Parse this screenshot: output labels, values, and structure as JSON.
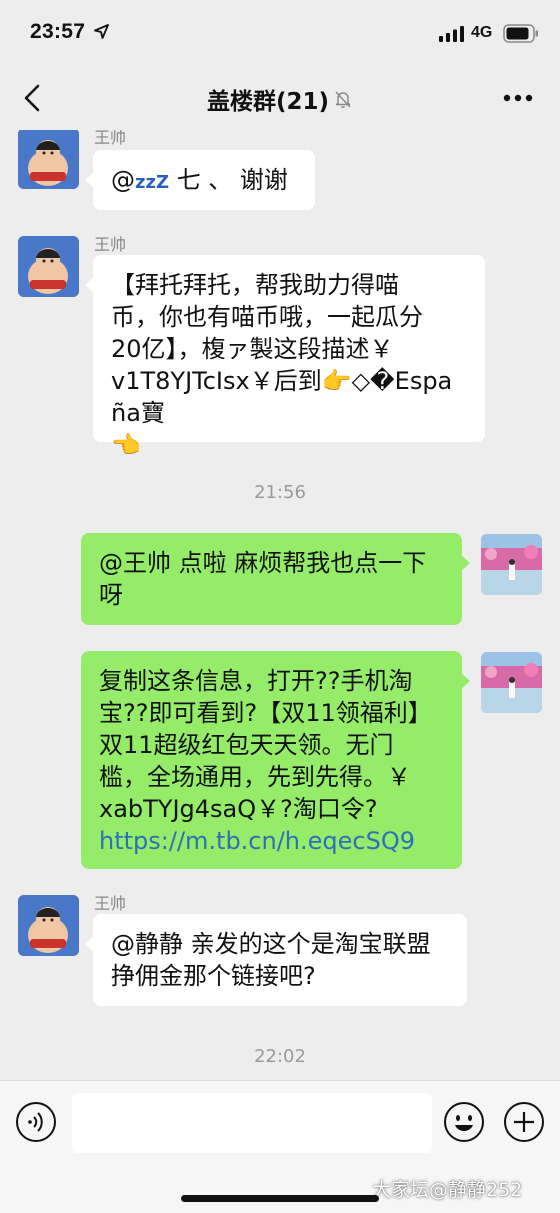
{
  "status_bar": {
    "time": "23:57",
    "network": "4G",
    "icons": [
      "location-arrow-icon",
      "signal-bars-icon",
      "battery-icon"
    ]
  },
  "nav": {
    "title": "盖楼群(21)",
    "icons": [
      "back-icon",
      "mute-bell-icon",
      "more-icon"
    ]
  },
  "messages": [
    {
      "side": "left",
      "sender": "王帅",
      "segments": [
        "@",
        "七 、 谢谢"
      ],
      "zzz": "zzZ"
    },
    {
      "side": "left",
      "sender": "王帅",
      "lines": [
        "【拜托拜托，帮我助力得喵",
        "币，你也有喵币哦，一起瓜分",
        "20亿】，椱ァ製这段描述￥",
        "v1T8YJTcIsx￥后到👉◇�España寶",
        "👈"
      ]
    },
    {
      "side": "right",
      "lines": [
        "@王帅 点啦 麻烦帮我也点一下",
        "呀"
      ]
    },
    {
      "side": "right",
      "lines": [
        "复制这条信息，打开??手机淘",
        "宝??即可看到?【双11领福利】",
        "双11超级红包天天领。无门",
        "槛，全场通用，先到先得。￥",
        "xabTYJg4saQ￥?淘口令?"
      ],
      "link": "https://m.tb.cn/h.eqecSQ9"
    },
    {
      "side": "left",
      "sender": "王帅",
      "lines": [
        "@静静 亲发的这个是淘宝联盟",
        "挣佣金那个链接吧?"
      ]
    }
  ],
  "timestamps": [
    "21:56",
    "22:02"
  ],
  "input_bar": {
    "placeholder": "",
    "icons": [
      "voice-icon",
      "emoji-icon",
      "plus-icon"
    ]
  },
  "watermark": "大家坛@静静252",
  "colors": {
    "background": "#ededed",
    "bubble_left": "#ffffff",
    "bubble_right": "#95ec69",
    "link": "#2f6fb8"
  }
}
